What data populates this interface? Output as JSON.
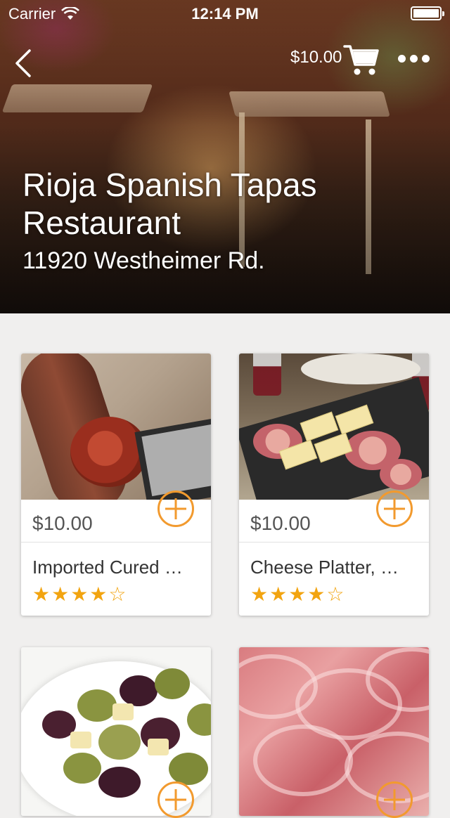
{
  "status_bar": {
    "carrier": "Carrier",
    "time": "12:14 PM",
    "battery_level": 1.0
  },
  "header": {
    "back_icon": "chevron-left-icon",
    "cart_total": "$10.00",
    "cart_icon": "shopping-cart-icon",
    "more_icon": "more-horizontal-icon"
  },
  "restaurant": {
    "name": "Rioja Spanish Tapas Restaurant",
    "address": "11920 Westheimer Rd."
  },
  "colors": {
    "accent": "#f29a2e",
    "star": "#f2a410",
    "background": "#f0efee"
  },
  "items": [
    {
      "price": "$10.00",
      "title": "Imported Cured …",
      "rating": 4,
      "rating_max": 5,
      "stars": "★★★★☆",
      "add_icon": "plus-circle-icon"
    },
    {
      "price": "$10.00",
      "title": "Cheese Platter, …",
      "rating": 4,
      "rating_max": 5,
      "stars": "★★★★☆",
      "add_icon": "plus-circle-icon"
    },
    {
      "add_icon": "plus-circle-icon"
    },
    {
      "add_icon": "plus-circle-icon"
    }
  ]
}
